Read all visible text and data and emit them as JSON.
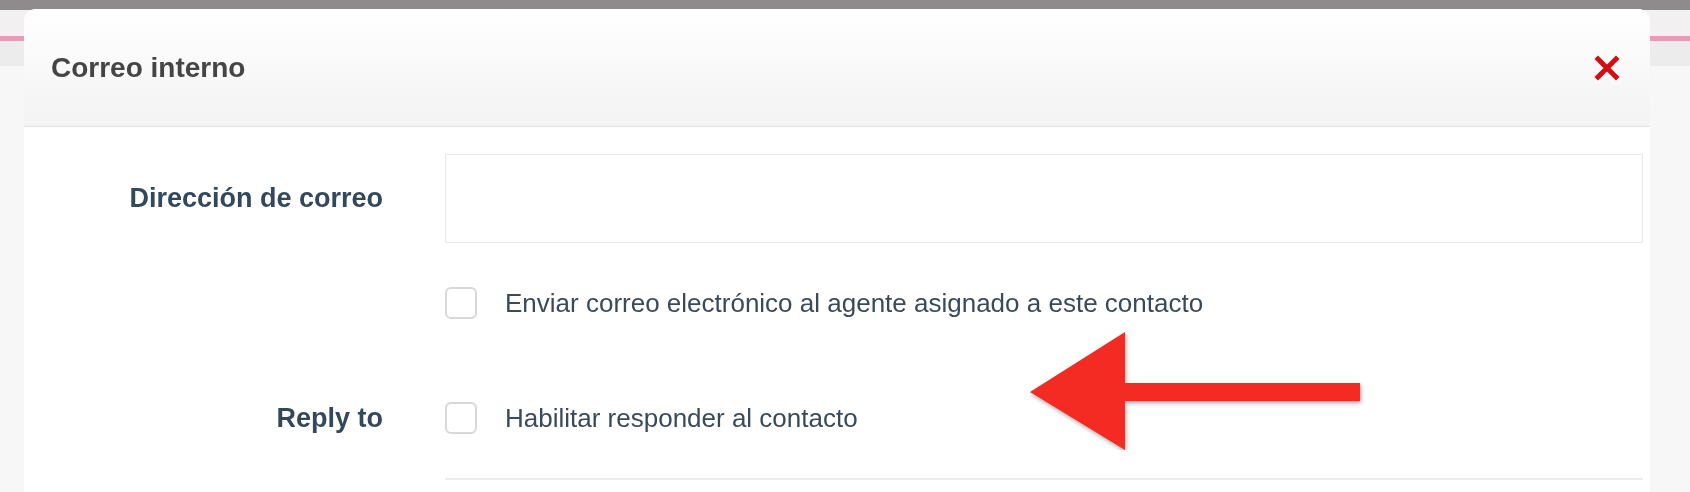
{
  "dialog": {
    "title": "Correo interno"
  },
  "rows": [
    {
      "kind": "input",
      "label": "Dirección de correo",
      "value": ""
    },
    {
      "kind": "checkbox",
      "text": "Enviar correo electrónico al agente asignado a este contacto",
      "checked": false
    },
    {
      "kind": "checkbox",
      "label": "Reply to",
      "text": "Habilitar responder al contacto",
      "checked": false
    }
  ]
}
